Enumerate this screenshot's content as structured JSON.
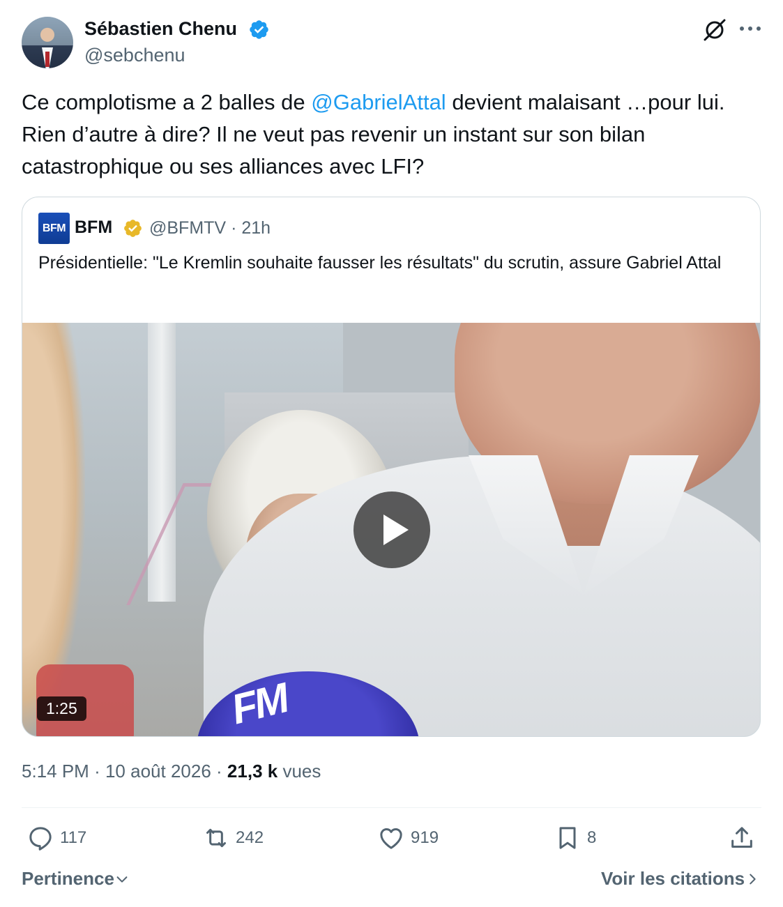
{
  "author": {
    "display_name": "Sébastien Chenu",
    "handle": "@sebchenu",
    "verified_color": "#1d9bf0"
  },
  "tweet": {
    "text_before": "Ce complotisme a 2 balles de ",
    "mention": "@GabrielAttal",
    "text_after": " devient malaisant …pour lui. Rien d’autre à dire? Il ne veut pas revenir un instant sur son bilan catastrophique ou ses alliances avec LFI?"
  },
  "quote": {
    "avatar_text": "BFM",
    "name": "BFM",
    "handle": "@BFMTV",
    "separator": "·",
    "age": "21h",
    "text": "Présidentielle: \"Le Kremlin souhaite fausser les résultats\" du scrutin, assure Gabriel Attal",
    "verified_color": "#e8b829",
    "video": {
      "duration": "1:25",
      "mic_logo": "FM"
    }
  },
  "meta": {
    "time": "5:14 PM",
    "separator": "·",
    "date": "10 août 2026",
    "views_count": "21,3 k",
    "views_label": "vues"
  },
  "actions": {
    "replies": "117",
    "reposts": "242",
    "likes": "919",
    "bookmarks": "8"
  },
  "footer": {
    "sort_label": "Pertinence",
    "quotes_label": "Voir les citations"
  },
  "icons": {
    "verified": "verified-badge-icon",
    "grok": "grok-icon",
    "more": "more-icon",
    "reply": "reply-icon",
    "repost": "repost-icon",
    "like": "heart-icon",
    "bookmark": "bookmark-icon",
    "share": "share-icon",
    "play": "play-icon"
  }
}
